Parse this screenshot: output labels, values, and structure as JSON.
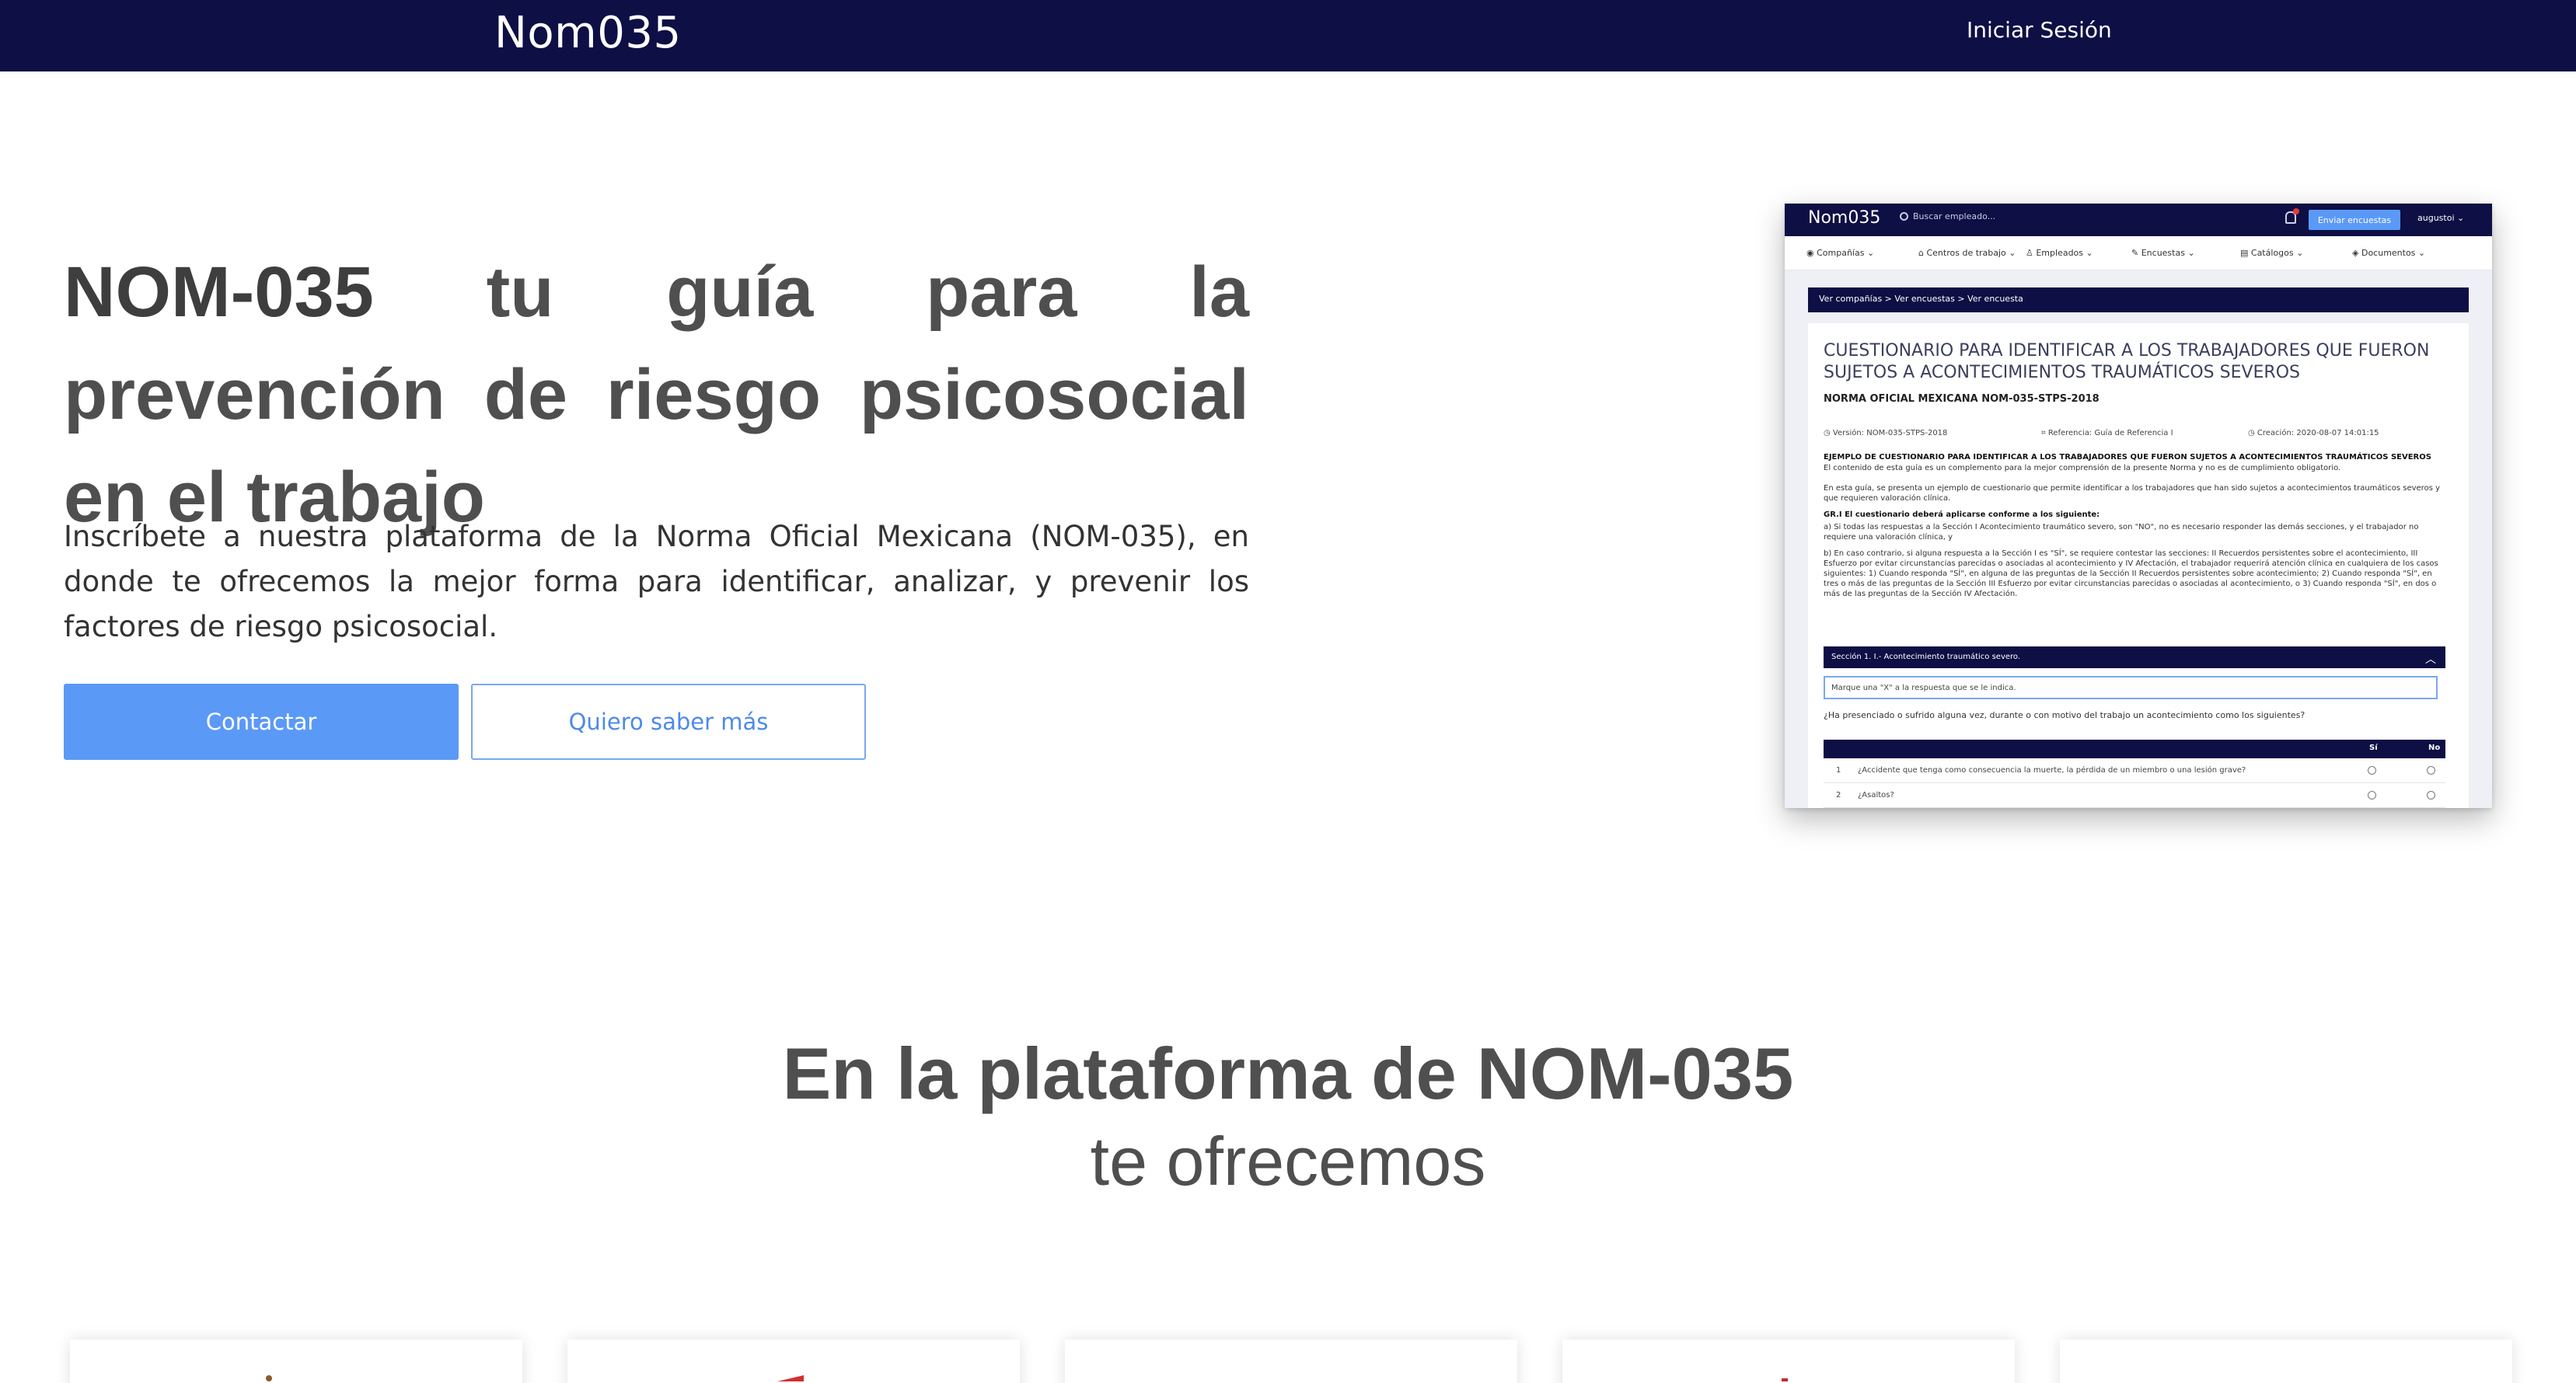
{
  "navbar": {
    "brand": "Nom035",
    "login": "Iniciar Sesión"
  },
  "hero": {
    "title_bold": "NOM-035",
    "title_rest": " tu guía para la prevención de riesgo psicosocial en el trabajo",
    "description": "Inscríbete a nuestra plataforma de la Norma Oficial Mexicana (NOM-035), en donde te ofrecemos la mejor forma para identificar, analizar, y prevenir los factores de riesgo psicosocial.",
    "contact_button": "Contactar",
    "more_button": "Quiero saber más"
  },
  "app_preview": {
    "brand": "Nom035",
    "search_placeholder": "Buscar empleado...",
    "send_button": "Enviar encuestas",
    "user": "augustoi",
    "menu": [
      "Compañías",
      "Centros de trabajo",
      "Empleados",
      "Encuestas",
      "Catálogos",
      "Documentos"
    ],
    "breadcrumb": "Ver compañías  >  Ver encuestas  >  Ver encuesta",
    "questionnaire_title": "CUESTIONARIO PARA IDENTIFICAR A LOS TRABAJADORES QUE FUERON SUJETOS A ACONTECIMIENTOS TRAUMÁTICOS SEVEROS",
    "norm": "NORMA OFICIAL MEXICANA NOM-035-STPS-2018",
    "version": "Versión: NOM-035-STPS-2018",
    "reference": "Referencia: Guía de Referencia I",
    "created": "Creación: 2020-08-07 14:01:15",
    "example_heading": "EJEMPLO DE CUESTIONARIO PARA IDENTIFICAR A LOS TRABAJADORES QUE FUERON SUJETOS A ACONTECIMIENTOS TRAUMÁTICOS SEVEROS",
    "para1": "El contenido de esta guía es un complemento para la mejor comprensión de la presente Norma y no es de cumplimiento obligatorio.",
    "para2": "En esta guía, se presenta un ejemplo de cuestionario que permite identificar a los trabajadores que han sido sujetos a acontecimientos traumáticos severos y que requieren valoración clínica.",
    "para3_heading": "GR.I El cuestionario deberá aplicarse conforme a los siguiente:",
    "para3": "a) Si todas las respuestas a la Sección I Acontecimiento traumático severo, son \"NO\", no es necesario responder las demás secciones, y el trabajador no requiere una valoración clínica, y",
    "para4": "b) En caso contrario, si alguna respuesta a la Sección I es \"SÍ\", se requiere contestar las secciones: II Recuerdos persistentes sobre el acontecimiento, III Esfuerzo por evitar circunstancias parecidas o asociadas al acontecimiento y IV Afectación, el trabajador requerirá atención clínica en cualquiera de los casos siguientes: 1) Cuando responda \"SÍ\", en alguna de las preguntas de la Sección II Recuerdos persistentes sobre acontecimiento; 2) Cuando responda \"SÍ\", en tres o más de las preguntas de la Sección III Esfuerzo por evitar circunstancias parecidas o asociadas al acontecimiento, o 3) Cuando responda \"SÍ\", en dos o más de las preguntas de la Sección IV Afectación.",
    "section_title": "Sección 1. I.- Acontecimiento traumático severo.",
    "instruction": "Marque una \"X\" a la respuesta que se le indica.",
    "question": "¿Ha presenciado o sufrido alguna vez, durante o con motivo del trabajo un acontecimiento como los siguientes?",
    "col_yes": "Sí",
    "col_no": "No",
    "rows": [
      {
        "n": "1",
        "text": "¿Accidente que tenga como consecuencia la muerte, la pérdida de un miembro o una lesión grave?"
      },
      {
        "n": "2",
        "text": "¿Asaltos?"
      }
    ]
  },
  "features": {
    "title": "En la plataforma de NOM-035",
    "subtitle": "te ofrecemos"
  },
  "colors": {
    "navy": "#0d0f45",
    "accent": "#5b99f7"
  }
}
